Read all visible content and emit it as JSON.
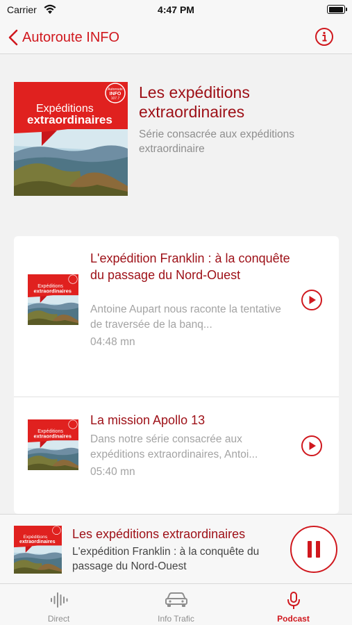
{
  "status_bar": {
    "carrier": "Carrier",
    "time": "4:47 PM"
  },
  "nav": {
    "back_title": "Autoroute INFO",
    "info_icon": "info-icon"
  },
  "cover_art": {
    "title_line1": "Expéditions",
    "title_line2": "extraordinaires",
    "logo_line1": "Autoroute",
    "logo_line2": "INFO",
    "logo_line3": "107.7"
  },
  "podcast": {
    "title": "Les expéditions extraordinaires",
    "description": "Série consacrée aux expéditions extraordinaire"
  },
  "episodes": [
    {
      "title": "L'expédition Franklin : à la conquête du passage du Nord-Ouest",
      "description": "Antoine Aupart nous raconte la tentative de traversée de la banq...",
      "duration": "04:48 mn"
    },
    {
      "title": "La mission Apollo 13",
      "description": "Dans notre série consacrée aux expéditions extraordinaires, Antoi...",
      "duration": "05:40 mn"
    }
  ],
  "mini_player": {
    "title": "Les expéditions extraordinaires",
    "subtitle": "L'expédition Franklin : à la conquête du passage du Nord-Ouest",
    "state": "playing"
  },
  "tabs": [
    {
      "label": "Direct",
      "icon": "waveform-icon",
      "active": false
    },
    {
      "label": "Info Trafic",
      "icon": "car-icon",
      "active": false
    },
    {
      "label": "Podcast",
      "icon": "microphone-icon",
      "active": true
    }
  ],
  "colors": {
    "accent": "#d0181e",
    "title_red": "#9d0f16"
  }
}
